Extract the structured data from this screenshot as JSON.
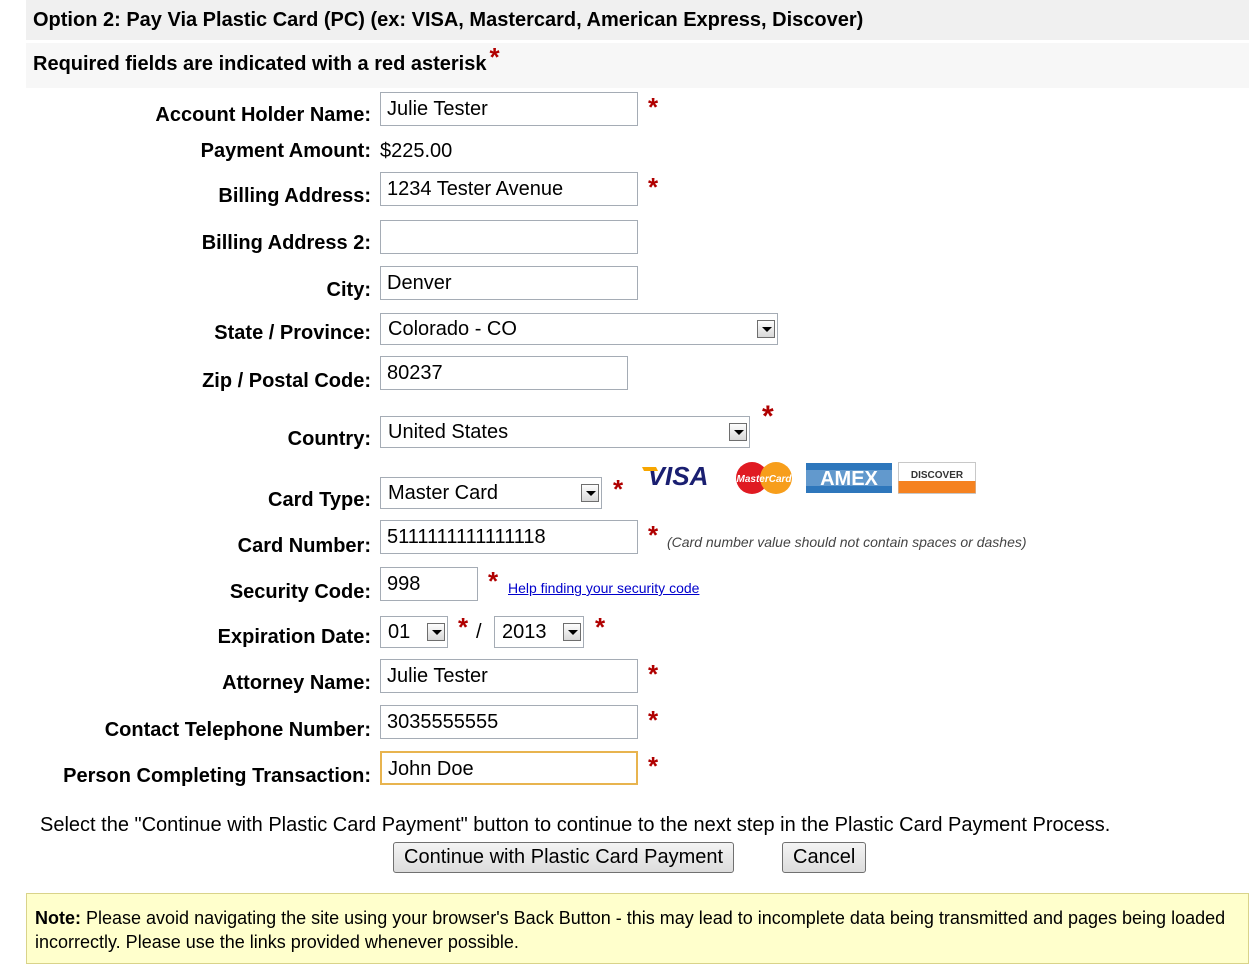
{
  "header": {
    "title": "Option 2: Pay Via Plastic Card (PC) (ex: VISA, Mastercard, American Express, Discover)",
    "required_note": "Required fields are indicated with a red asterisk",
    "asterisk": "*"
  },
  "form": {
    "account_holder": {
      "label": "Account Holder Name:",
      "value": "Julie Tester"
    },
    "payment_amount": {
      "label": "Payment Amount:",
      "value": "$225.00"
    },
    "billing_address": {
      "label": "Billing Address:",
      "value": "1234 Tester Avenue"
    },
    "billing_address2": {
      "label": "Billing Address 2:",
      "value": ""
    },
    "city": {
      "label": "City:",
      "value": "Denver"
    },
    "state": {
      "label": "State / Province:",
      "value": "Colorado - CO"
    },
    "zip": {
      "label": "Zip / Postal Code:",
      "value": "80237"
    },
    "country": {
      "label": "Country:",
      "value": "United States"
    },
    "card_type": {
      "label": "Card Type:",
      "value": "Master Card"
    },
    "card_number": {
      "label": "Card Number:",
      "value": "5111111111111118",
      "hint": "(Card number value should not contain spaces or dashes)"
    },
    "security_code": {
      "label": "Security Code:",
      "value": "998",
      "help_link": "Help finding your security code"
    },
    "expiration": {
      "label": "Expiration Date:",
      "month": "01",
      "year": "2013",
      "separator": "/"
    },
    "attorney": {
      "label": "Attorney Name:",
      "value": "Julie Tester"
    },
    "phone": {
      "label": "Contact Telephone Number:",
      "value": "3035555555"
    },
    "person": {
      "label": "Person Completing Transaction:",
      "value": "John Doe"
    }
  },
  "card_logos": {
    "visa": "VISA",
    "mastercard": "MasterCard",
    "amex": "AMEX",
    "discover": "DISCOVER"
  },
  "actions": {
    "instruction": "Select the \"Continue with Plastic Card Payment\" button to continue to the next step in the Plastic Card Payment Process.",
    "continue_label": "Continue with Plastic Card Payment",
    "cancel_label": "Cancel"
  },
  "note": {
    "prefix": "Note:",
    "text": " Please avoid navigating the site using your browser's Back Button - this may lead to incomplete data being transmitted and pages being loaded incorrectly. Please use the links provided whenever possible."
  },
  "colors": {
    "required": "#b00000",
    "link": "#0000cc",
    "note_bg": "#ffffcc"
  }
}
